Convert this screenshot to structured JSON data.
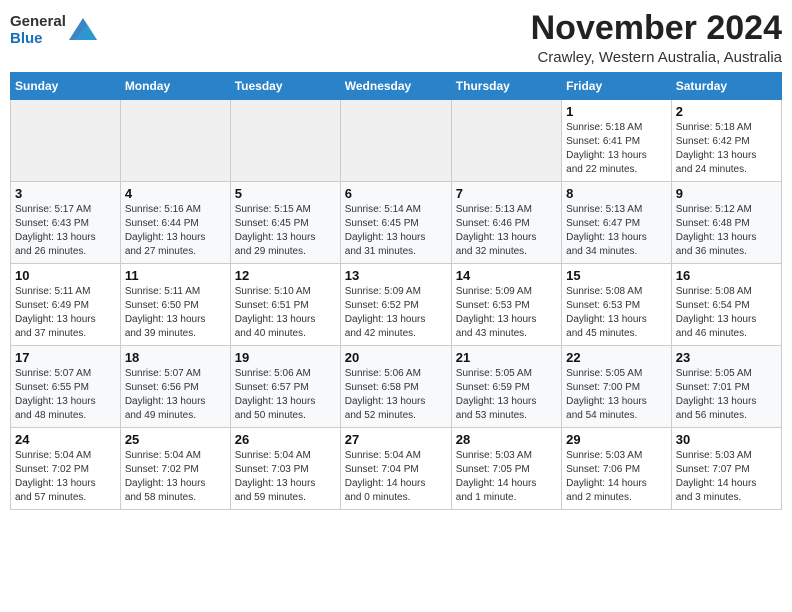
{
  "header": {
    "logo_line1": "General",
    "logo_line2": "Blue",
    "month": "November 2024",
    "location": "Crawley, Western Australia, Australia"
  },
  "weekdays": [
    "Sunday",
    "Monday",
    "Tuesday",
    "Wednesday",
    "Thursday",
    "Friday",
    "Saturday"
  ],
  "weeks": [
    [
      {
        "day": "",
        "detail": ""
      },
      {
        "day": "",
        "detail": ""
      },
      {
        "day": "",
        "detail": ""
      },
      {
        "day": "",
        "detail": ""
      },
      {
        "day": "",
        "detail": ""
      },
      {
        "day": "1",
        "detail": "Sunrise: 5:18 AM\nSunset: 6:41 PM\nDaylight: 13 hours\nand 22 minutes."
      },
      {
        "day": "2",
        "detail": "Sunrise: 5:18 AM\nSunset: 6:42 PM\nDaylight: 13 hours\nand 24 minutes."
      }
    ],
    [
      {
        "day": "3",
        "detail": "Sunrise: 5:17 AM\nSunset: 6:43 PM\nDaylight: 13 hours\nand 26 minutes."
      },
      {
        "day": "4",
        "detail": "Sunrise: 5:16 AM\nSunset: 6:44 PM\nDaylight: 13 hours\nand 27 minutes."
      },
      {
        "day": "5",
        "detail": "Sunrise: 5:15 AM\nSunset: 6:45 PM\nDaylight: 13 hours\nand 29 minutes."
      },
      {
        "day": "6",
        "detail": "Sunrise: 5:14 AM\nSunset: 6:45 PM\nDaylight: 13 hours\nand 31 minutes."
      },
      {
        "day": "7",
        "detail": "Sunrise: 5:13 AM\nSunset: 6:46 PM\nDaylight: 13 hours\nand 32 minutes."
      },
      {
        "day": "8",
        "detail": "Sunrise: 5:13 AM\nSunset: 6:47 PM\nDaylight: 13 hours\nand 34 minutes."
      },
      {
        "day": "9",
        "detail": "Sunrise: 5:12 AM\nSunset: 6:48 PM\nDaylight: 13 hours\nand 36 minutes."
      }
    ],
    [
      {
        "day": "10",
        "detail": "Sunrise: 5:11 AM\nSunset: 6:49 PM\nDaylight: 13 hours\nand 37 minutes."
      },
      {
        "day": "11",
        "detail": "Sunrise: 5:11 AM\nSunset: 6:50 PM\nDaylight: 13 hours\nand 39 minutes."
      },
      {
        "day": "12",
        "detail": "Sunrise: 5:10 AM\nSunset: 6:51 PM\nDaylight: 13 hours\nand 40 minutes."
      },
      {
        "day": "13",
        "detail": "Sunrise: 5:09 AM\nSunset: 6:52 PM\nDaylight: 13 hours\nand 42 minutes."
      },
      {
        "day": "14",
        "detail": "Sunrise: 5:09 AM\nSunset: 6:53 PM\nDaylight: 13 hours\nand 43 minutes."
      },
      {
        "day": "15",
        "detail": "Sunrise: 5:08 AM\nSunset: 6:53 PM\nDaylight: 13 hours\nand 45 minutes."
      },
      {
        "day": "16",
        "detail": "Sunrise: 5:08 AM\nSunset: 6:54 PM\nDaylight: 13 hours\nand 46 minutes."
      }
    ],
    [
      {
        "day": "17",
        "detail": "Sunrise: 5:07 AM\nSunset: 6:55 PM\nDaylight: 13 hours\nand 48 minutes."
      },
      {
        "day": "18",
        "detail": "Sunrise: 5:07 AM\nSunset: 6:56 PM\nDaylight: 13 hours\nand 49 minutes."
      },
      {
        "day": "19",
        "detail": "Sunrise: 5:06 AM\nSunset: 6:57 PM\nDaylight: 13 hours\nand 50 minutes."
      },
      {
        "day": "20",
        "detail": "Sunrise: 5:06 AM\nSunset: 6:58 PM\nDaylight: 13 hours\nand 52 minutes."
      },
      {
        "day": "21",
        "detail": "Sunrise: 5:05 AM\nSunset: 6:59 PM\nDaylight: 13 hours\nand 53 minutes."
      },
      {
        "day": "22",
        "detail": "Sunrise: 5:05 AM\nSunset: 7:00 PM\nDaylight: 13 hours\nand 54 minutes."
      },
      {
        "day": "23",
        "detail": "Sunrise: 5:05 AM\nSunset: 7:01 PM\nDaylight: 13 hours\nand 56 minutes."
      }
    ],
    [
      {
        "day": "24",
        "detail": "Sunrise: 5:04 AM\nSunset: 7:02 PM\nDaylight: 13 hours\nand 57 minutes."
      },
      {
        "day": "25",
        "detail": "Sunrise: 5:04 AM\nSunset: 7:02 PM\nDaylight: 13 hours\nand 58 minutes."
      },
      {
        "day": "26",
        "detail": "Sunrise: 5:04 AM\nSunset: 7:03 PM\nDaylight: 13 hours\nand 59 minutes."
      },
      {
        "day": "27",
        "detail": "Sunrise: 5:04 AM\nSunset: 7:04 PM\nDaylight: 14 hours\nand 0 minutes."
      },
      {
        "day": "28",
        "detail": "Sunrise: 5:03 AM\nSunset: 7:05 PM\nDaylight: 14 hours\nand 1 minute."
      },
      {
        "day": "29",
        "detail": "Sunrise: 5:03 AM\nSunset: 7:06 PM\nDaylight: 14 hours\nand 2 minutes."
      },
      {
        "day": "30",
        "detail": "Sunrise: 5:03 AM\nSunset: 7:07 PM\nDaylight: 14 hours\nand 3 minutes."
      }
    ]
  ]
}
